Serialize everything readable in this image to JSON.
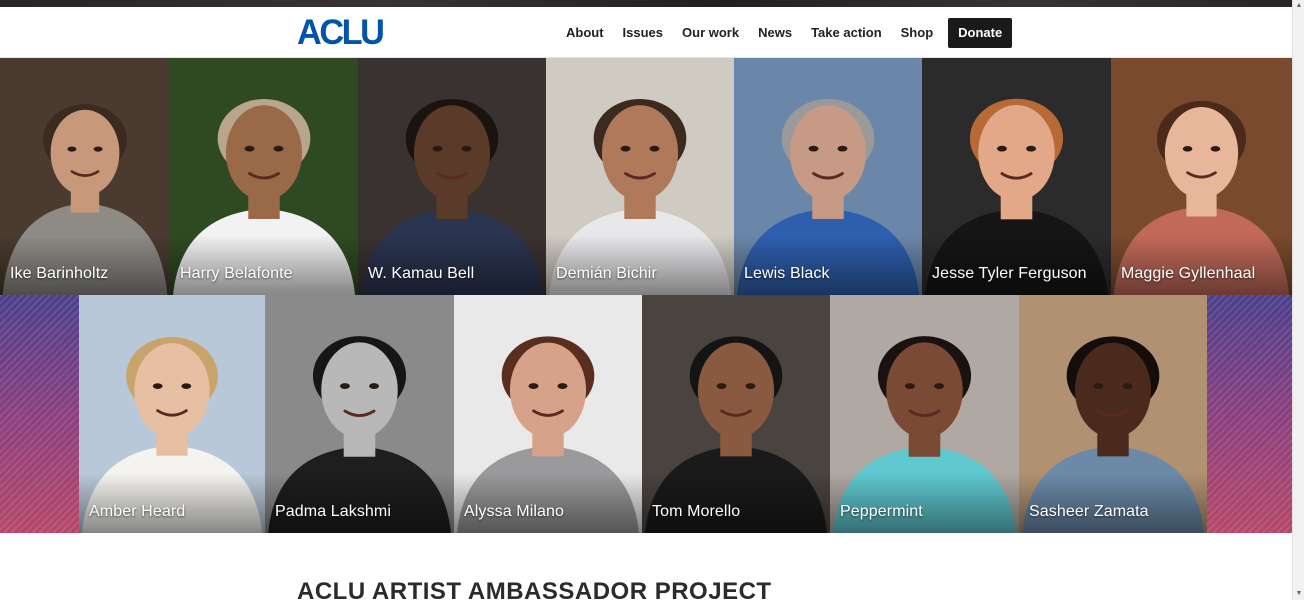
{
  "header": {
    "logo_text": "ACLU",
    "nav": [
      {
        "label": "About"
      },
      {
        "label": "Issues"
      },
      {
        "label": "Our work"
      },
      {
        "label": "News"
      },
      {
        "label": "Take action"
      },
      {
        "label": "Shop"
      }
    ],
    "donate_label": "Donate"
  },
  "row1": [
    {
      "name": "Ike Barinholtz",
      "bg": "#4a3a30",
      "skin": "#c8987a",
      "hair": "#3a2a20",
      "shirt": "#8e8b86"
    },
    {
      "name": "Harry Belafonte",
      "bg": "#2f4a22",
      "skin": "#9a6a48",
      "hair": "#b8a58c",
      "shirt": "#f2f2f2"
    },
    {
      "name": "W. Kamau Bell",
      "bg": "#3a3230",
      "skin": "#5a3a28",
      "hair": "#1a1411",
      "shirt": "#2b3550"
    },
    {
      "name": "Demián Bichir",
      "bg": "#cfcac2",
      "skin": "#b07a5a",
      "hair": "#3b2a1f",
      "shirt": "#e8e8ea"
    },
    {
      "name": "Lewis Black",
      "bg": "#6a86a8",
      "skin": "#c79a86",
      "hair": "#9a9a9a",
      "shirt": "#2e5fae"
    },
    {
      "name": "Jesse Tyler Ferguson",
      "bg": "#2b2b2b",
      "skin": "#e2a888",
      "hair": "#b86a36",
      "shirt": "#151515"
    },
    {
      "name": "Maggie Gyllenhaal",
      "bg": "#7a4a2e",
      "skin": "#e8b69a",
      "hair": "#4a2a1a",
      "shirt": "#c26a5a"
    }
  ],
  "row2": [
    {
      "name": "Amber Heard",
      "bg": "#b8c8d8",
      "skin": "#e7c0a4",
      "hair": "#c9a46a",
      "shirt": "#f5f3ef"
    },
    {
      "name": "Padma Lakshmi",
      "bg": "#8a8a8a",
      "skin": "#b8b8b8",
      "hair": "#161616",
      "shirt": "#1e1e1e"
    },
    {
      "name": "Alyssa Milano",
      "bg": "#e9e9ea",
      "skin": "#d7a28a",
      "hair": "#5a2e1e",
      "shirt": "#9a9a9c"
    },
    {
      "name": "Tom Morello",
      "bg": "#4a4440",
      "skin": "#8a5a40",
      "hair": "#141414",
      "shirt": "#1a1a1a"
    },
    {
      "name": "Peppermint",
      "bg": "#b0a8a2",
      "skin": "#7a4a34",
      "hair": "#1a1210",
      "shirt": "#5fc8d0"
    },
    {
      "name": "Sasheer Zamata",
      "bg": "#b09272",
      "skin": "#4a2a1c",
      "hair": "#140d0a",
      "shirt": "#6c8aa8"
    }
  ],
  "section": {
    "title": "ACLU ARTIST AMBASSADOR PROJECT"
  }
}
